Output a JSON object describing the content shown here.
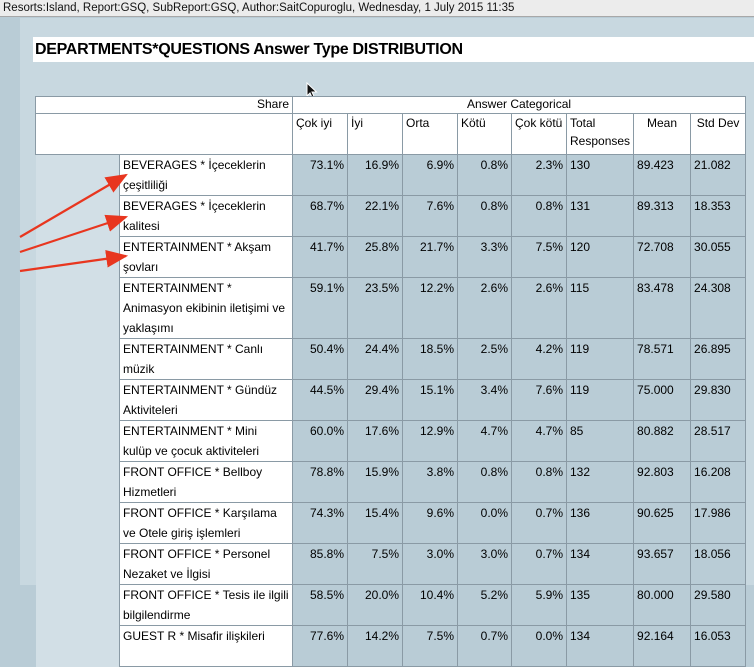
{
  "window": {
    "status_line": "Resorts:Island, Report:GSQ, SubReport:GSQ, Author:SaitCopuroglu,  Wednesday, 1 July 2015 11:35"
  },
  "report": {
    "title": "DEPARTMENTS*QUESTIONS Answer Type DISTRIBUTION",
    "share_label": "Share",
    "group_label": "Answer Categorical",
    "columns": [
      "Çok iyi",
      "İyi",
      "Orta",
      "Kötü",
      "Çok kötü",
      "Total Responses",
      "Mean",
      "Std Dev"
    ],
    "rows": [
      {
        "label": "BEVERAGES * İçeceklerin çeşitliliği",
        "v": [
          "73.1%",
          "16.9%",
          "6.9%",
          "0.8%",
          "2.3%",
          "130",
          "89.423",
          "21.082"
        ]
      },
      {
        "label": "BEVERAGES * İçeceklerin kalitesi",
        "v": [
          "68.7%",
          "22.1%",
          "7.6%",
          "0.8%",
          "0.8%",
          "131",
          "89.313",
          "18.353"
        ]
      },
      {
        "label": "ENTERTAINMENT * Akşam şovları",
        "v": [
          "41.7%",
          "25.8%",
          "21.7%",
          "3.3%",
          "7.5%",
          "120",
          "72.708",
          "30.055"
        ]
      },
      {
        "label": "ENTERTAINMENT * Animasyon ekibinin iletişimi ve yaklaşımı",
        "v": [
          "59.1%",
          "23.5%",
          "12.2%",
          "2.6%",
          "2.6%",
          "115",
          "83.478",
          "24.308"
        ]
      },
      {
        "label": "ENTERTAINMENT * Canlı müzik",
        "v": [
          "50.4%",
          "24.4%",
          "18.5%",
          "2.5%",
          "4.2%",
          "119",
          "78.571",
          "26.895"
        ]
      },
      {
        "label": "ENTERTAINMENT * Gündüz Aktiviteleri",
        "v": [
          "44.5%",
          "29.4%",
          "15.1%",
          "3.4%",
          "7.6%",
          "119",
          "75.000",
          "29.830"
        ]
      },
      {
        "label": "ENTERTAINMENT * Mini kulüp ve çocuk aktiviteleri",
        "v": [
          "60.0%",
          "17.6%",
          "12.9%",
          "4.7%",
          "4.7%",
          "85",
          "80.882",
          "28.517"
        ]
      },
      {
        "label": "FRONT OFFICE * Bellboy Hizmetleri",
        "v": [
          "78.8%",
          "15.9%",
          "3.8%",
          "0.8%",
          "0.8%",
          "132",
          "92.803",
          "16.208"
        ]
      },
      {
        "label": "FRONT OFFICE * Karşılama ve Otele giriş işlemleri",
        "v": [
          "74.3%",
          "15.4%",
          "9.6%",
          "0.0%",
          "0.7%",
          "136",
          "90.625",
          "17.986"
        ]
      },
      {
        "label": "FRONT OFFICE * Personel Nezaket ve İlgisi",
        "v": [
          "85.8%",
          "7.5%",
          "3.0%",
          "3.0%",
          "0.7%",
          "134",
          "93.657",
          "18.056"
        ]
      },
      {
        "label": "FRONT OFFICE * Tesis ile ilgili bilgilendirme",
        "v": [
          "58.5%",
          "20.0%",
          "10.4%",
          "5.2%",
          "5.9%",
          "135",
          "80.000",
          "29.580"
        ]
      },
      {
        "label": "GUEST R * Misafir ilişkileri",
        "v": [
          "77.6%",
          "14.2%",
          "7.5%",
          "0.7%",
          "0.0%",
          "134",
          "92.164",
          "16.053"
        ]
      }
    ]
  },
  "annotations": {
    "arrow_color": "#e8361f"
  }
}
